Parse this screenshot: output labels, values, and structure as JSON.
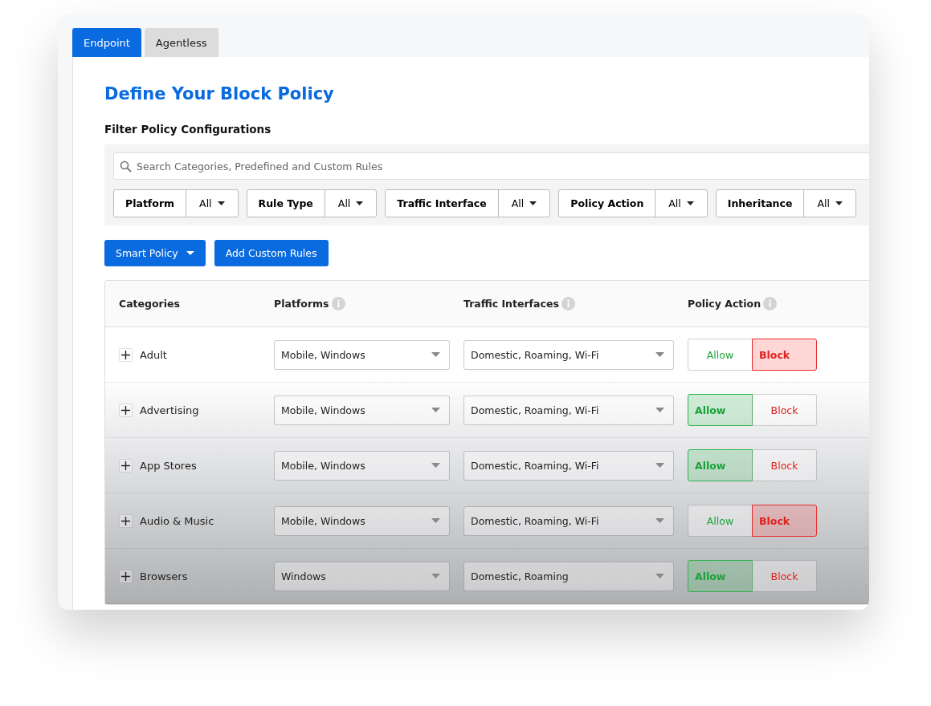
{
  "tabs": [
    {
      "label": "Endpoint",
      "selected": true
    },
    {
      "label": "Agentless",
      "selected": false
    }
  ],
  "title": "Define Your Block Policy",
  "filter_heading": "Filter Policy Configurations",
  "search": {
    "placeholder": "Search Categories, Predefined and Custom Rules"
  },
  "filters": [
    {
      "label": "Platform",
      "value": "All"
    },
    {
      "label": "Rule Type",
      "value": "All"
    },
    {
      "label": "Traffic Interface",
      "value": "All"
    },
    {
      "label": "Policy Action",
      "value": "All"
    },
    {
      "label": "Inheritance",
      "value": "All"
    }
  ],
  "buttons": [
    {
      "label": "Smart Policy",
      "has_caret": true
    },
    {
      "label": "Add Custom Rules",
      "has_caret": false
    }
  ],
  "table": {
    "columns": [
      {
        "label": "Categories",
        "info": false
      },
      {
        "label": "Platforms",
        "info": true
      },
      {
        "label": "Traffic Interfaces",
        "info": true
      },
      {
        "label": "Policy Action",
        "info": true
      }
    ],
    "rows": [
      {
        "category": "Adult",
        "platforms": "Mobile, Windows",
        "interfaces": "Domestic, Roaming, Wi-Fi",
        "actions": [
          {
            "label": "Allow",
            "kind": "allow",
            "selected": false
          },
          {
            "label": "Block",
            "kind": "block",
            "selected": true
          }
        ]
      },
      {
        "category": "Advertising",
        "platforms": "Mobile, Windows",
        "interfaces": "Domestic, Roaming, Wi-Fi",
        "actions": [
          {
            "label": "Allow",
            "kind": "allow",
            "selected": true
          },
          {
            "label": "Block",
            "kind": "block",
            "selected": false
          }
        ]
      },
      {
        "category": "App Stores",
        "platforms": "Mobile, Windows",
        "interfaces": "Domestic, Roaming, Wi-Fi",
        "actions": [
          {
            "label": "Allow",
            "kind": "allow",
            "selected": true
          },
          {
            "label": "Block",
            "kind": "block",
            "selected": false
          }
        ]
      },
      {
        "category": "Audio & Music",
        "platforms": "Mobile, Windows",
        "interfaces": "Domestic, Roaming, Wi-Fi",
        "actions": [
          {
            "label": "Allow",
            "kind": "allow",
            "selected": false
          },
          {
            "label": "Block",
            "kind": "block",
            "selected": true
          }
        ]
      },
      {
        "category": "Browsers",
        "platforms": "Windows",
        "interfaces": "Domestic, Roaming",
        "actions": [
          {
            "label": "Allow",
            "kind": "allow",
            "selected": true
          },
          {
            "label": "Block",
            "kind": "block",
            "selected": false
          }
        ]
      }
    ]
  }
}
